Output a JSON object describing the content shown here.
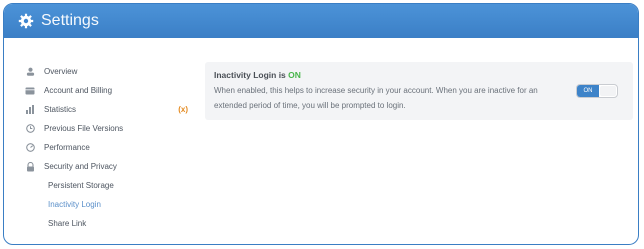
{
  "header": {
    "title": "Settings",
    "icon": "gear-icon"
  },
  "sidebar": {
    "items": [
      {
        "label": "Overview",
        "icon": "user-icon"
      },
      {
        "label": "Account and Billing",
        "icon": "card-icon"
      },
      {
        "label": "Statistics",
        "icon": "bar-chart-icon",
        "badge": "(x)"
      },
      {
        "label": "Previous File Versions",
        "icon": "clock-icon"
      },
      {
        "label": "Performance",
        "icon": "gauge-icon"
      },
      {
        "label": "Security and Privacy",
        "icon": "lock-icon"
      },
      {
        "label": "Persistent Storage"
      },
      {
        "label": "Inactivity Login"
      },
      {
        "label": "Share Link"
      }
    ]
  },
  "setting": {
    "title_prefix": "Inactivity Login is",
    "title_status": "ON",
    "description": "When enabled, this helps to increase security in your account. When you are inactive for an extended period of time, you will be prompted to login.",
    "toggle_label": "ON"
  },
  "colors": {
    "header": "#3b7fc6",
    "accent": "#5a8fc9",
    "on": "#47b54a",
    "badge": "#e48a1f"
  }
}
